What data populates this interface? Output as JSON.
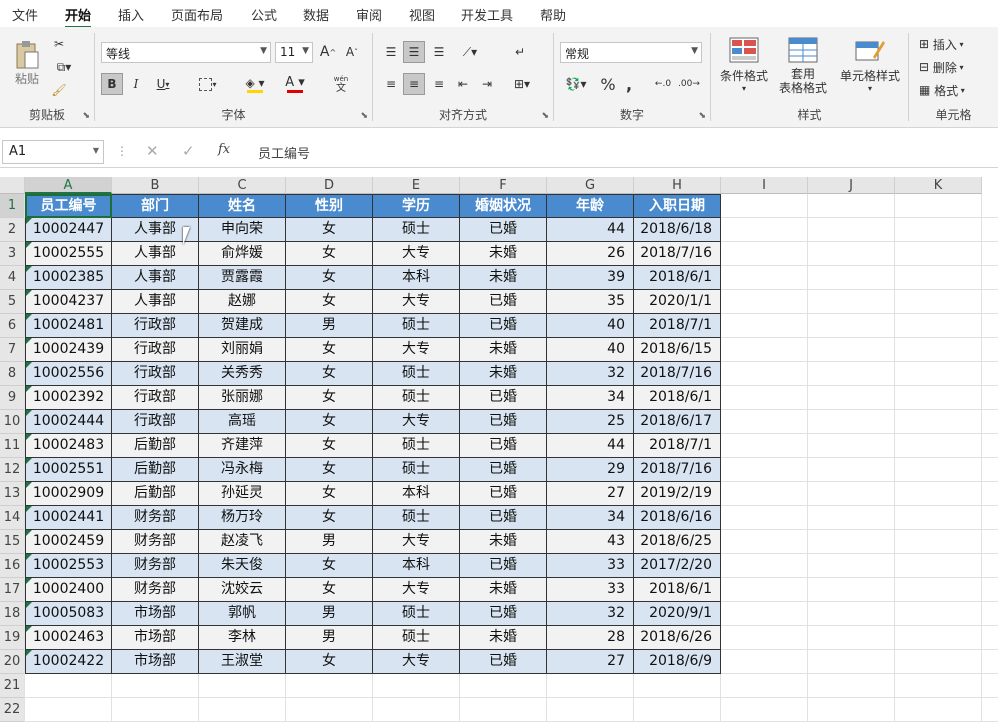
{
  "tabs": [
    "文件",
    "开始",
    "插入",
    "页面布局",
    "公式",
    "数据",
    "审阅",
    "视图",
    "开发工具",
    "帮助"
  ],
  "ribbon": {
    "clipboard": {
      "paste": "粘贴",
      "label": "剪贴板"
    },
    "font": {
      "name": "等线",
      "size": "11",
      "bold": "B",
      "italic": "I",
      "underline": "U",
      "grow": "A",
      "shrink": "A",
      "label": "字体",
      "wen": "wén",
      "wen2": "文"
    },
    "align": {
      "label": "对齐方式"
    },
    "number": {
      "format": "常规",
      "percent": "%",
      "label": "数字"
    },
    "styles": {
      "cond": "条件格式",
      "table1": "套用",
      "table2": "表格格式",
      "cell": "单元格样式",
      "label": "样式"
    },
    "cells": {
      "insert": "插入",
      "delete": "删除",
      "format": "格式",
      "label": "单元格"
    }
  },
  "formula_bar": {
    "name_box": "A1",
    "fx": "fx",
    "value": "员工编号"
  },
  "sheet": {
    "columns": [
      "A",
      "B",
      "C",
      "D",
      "E",
      "F",
      "G",
      "H",
      "I",
      "J",
      "K"
    ],
    "headers": [
      "员工编号",
      "部门",
      "姓名",
      "性别",
      "学历",
      "婚姻状况",
      "年龄",
      "入职日期"
    ],
    "rows": [
      [
        "10002447",
        "人事部",
        "申向荣",
        "女",
        "硕士",
        "已婚",
        "44",
        "2018/6/18"
      ],
      [
        "10002555",
        "人事部",
        "俞烨媛",
        "女",
        "大专",
        "未婚",
        "26",
        "2018/7/16"
      ],
      [
        "10002385",
        "人事部",
        "贾露霞",
        "女",
        "本科",
        "未婚",
        "39",
        "2018/6/1"
      ],
      [
        "10004237",
        "人事部",
        "赵娜",
        "女",
        "大专",
        "已婚",
        "35",
        "2020/1/1"
      ],
      [
        "10002481",
        "行政部",
        "贺建成",
        "男",
        "硕士",
        "已婚",
        "40",
        "2018/7/1"
      ],
      [
        "10002439",
        "行政部",
        "刘丽娟",
        "女",
        "大专",
        "未婚",
        "40",
        "2018/6/15"
      ],
      [
        "10002556",
        "行政部",
        "关秀秀",
        "女",
        "硕士",
        "未婚",
        "32",
        "2018/7/16"
      ],
      [
        "10002392",
        "行政部",
        "张丽娜",
        "女",
        "硕士",
        "已婚",
        "34",
        "2018/6/1"
      ],
      [
        "10002444",
        "行政部",
        "高瑶",
        "女",
        "大专",
        "已婚",
        "25",
        "2018/6/17"
      ],
      [
        "10002483",
        "后勤部",
        "齐建萍",
        "女",
        "硕士",
        "已婚",
        "44",
        "2018/7/1"
      ],
      [
        "10002551",
        "后勤部",
        "冯永梅",
        "女",
        "硕士",
        "已婚",
        "29",
        "2018/7/16"
      ],
      [
        "10002909",
        "后勤部",
        "孙延灵",
        "女",
        "本科",
        "已婚",
        "27",
        "2019/2/19"
      ],
      [
        "10002441",
        "财务部",
        "杨万玲",
        "女",
        "硕士",
        "已婚",
        "34",
        "2018/6/16"
      ],
      [
        "10002459",
        "财务部",
        "赵凌飞",
        "男",
        "大专",
        "未婚",
        "43",
        "2018/6/25"
      ],
      [
        "10002553",
        "财务部",
        "朱天俊",
        "女",
        "本科",
        "已婚",
        "33",
        "2017/2/20"
      ],
      [
        "10002400",
        "财务部",
        "沈姣云",
        "女",
        "大专",
        "未婚",
        "33",
        "2018/6/1"
      ],
      [
        "10005083",
        "市场部",
        "郭帆",
        "男",
        "硕士",
        "已婚",
        "32",
        "2020/9/1"
      ],
      [
        "10002463",
        "市场部",
        "李林",
        "男",
        "硕士",
        "未婚",
        "28",
        "2018/6/26"
      ],
      [
        "10002422",
        "市场部",
        "王淑堂",
        "女",
        "大专",
        "已婚",
        "27",
        "2018/6/9"
      ]
    ],
    "row_numbers": [
      "1",
      "2",
      "3",
      "4",
      "5",
      "6",
      "7",
      "8",
      "9",
      "10",
      "11",
      "12",
      "13",
      "14",
      "15",
      "16",
      "17",
      "18",
      "19",
      "20",
      "21",
      "22"
    ]
  }
}
